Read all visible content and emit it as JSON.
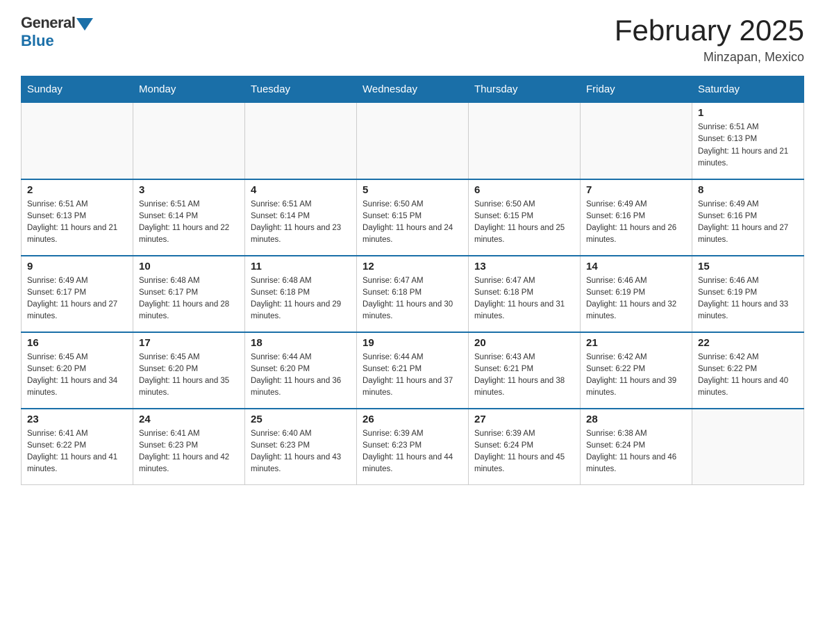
{
  "header": {
    "logo_general": "General",
    "logo_blue": "Blue",
    "month_title": "February 2025",
    "location": "Minzapan, Mexico"
  },
  "days_of_week": [
    "Sunday",
    "Monday",
    "Tuesday",
    "Wednesday",
    "Thursday",
    "Friday",
    "Saturday"
  ],
  "weeks": [
    [
      {
        "day": "",
        "sunrise": "",
        "sunset": "",
        "daylight": ""
      },
      {
        "day": "",
        "sunrise": "",
        "sunset": "",
        "daylight": ""
      },
      {
        "day": "",
        "sunrise": "",
        "sunset": "",
        "daylight": ""
      },
      {
        "day": "",
        "sunrise": "",
        "sunset": "",
        "daylight": ""
      },
      {
        "day": "",
        "sunrise": "",
        "sunset": "",
        "daylight": ""
      },
      {
        "day": "",
        "sunrise": "",
        "sunset": "",
        "daylight": ""
      },
      {
        "day": "1",
        "sunrise": "Sunrise: 6:51 AM",
        "sunset": "Sunset: 6:13 PM",
        "daylight": "Daylight: 11 hours and 21 minutes."
      }
    ],
    [
      {
        "day": "2",
        "sunrise": "Sunrise: 6:51 AM",
        "sunset": "Sunset: 6:13 PM",
        "daylight": "Daylight: 11 hours and 21 minutes."
      },
      {
        "day": "3",
        "sunrise": "Sunrise: 6:51 AM",
        "sunset": "Sunset: 6:14 PM",
        "daylight": "Daylight: 11 hours and 22 minutes."
      },
      {
        "day": "4",
        "sunrise": "Sunrise: 6:51 AM",
        "sunset": "Sunset: 6:14 PM",
        "daylight": "Daylight: 11 hours and 23 minutes."
      },
      {
        "day": "5",
        "sunrise": "Sunrise: 6:50 AM",
        "sunset": "Sunset: 6:15 PM",
        "daylight": "Daylight: 11 hours and 24 minutes."
      },
      {
        "day": "6",
        "sunrise": "Sunrise: 6:50 AM",
        "sunset": "Sunset: 6:15 PM",
        "daylight": "Daylight: 11 hours and 25 minutes."
      },
      {
        "day": "7",
        "sunrise": "Sunrise: 6:49 AM",
        "sunset": "Sunset: 6:16 PM",
        "daylight": "Daylight: 11 hours and 26 minutes."
      },
      {
        "day": "8",
        "sunrise": "Sunrise: 6:49 AM",
        "sunset": "Sunset: 6:16 PM",
        "daylight": "Daylight: 11 hours and 27 minutes."
      }
    ],
    [
      {
        "day": "9",
        "sunrise": "Sunrise: 6:49 AM",
        "sunset": "Sunset: 6:17 PM",
        "daylight": "Daylight: 11 hours and 27 minutes."
      },
      {
        "day": "10",
        "sunrise": "Sunrise: 6:48 AM",
        "sunset": "Sunset: 6:17 PM",
        "daylight": "Daylight: 11 hours and 28 minutes."
      },
      {
        "day": "11",
        "sunrise": "Sunrise: 6:48 AM",
        "sunset": "Sunset: 6:18 PM",
        "daylight": "Daylight: 11 hours and 29 minutes."
      },
      {
        "day": "12",
        "sunrise": "Sunrise: 6:47 AM",
        "sunset": "Sunset: 6:18 PM",
        "daylight": "Daylight: 11 hours and 30 minutes."
      },
      {
        "day": "13",
        "sunrise": "Sunrise: 6:47 AM",
        "sunset": "Sunset: 6:18 PM",
        "daylight": "Daylight: 11 hours and 31 minutes."
      },
      {
        "day": "14",
        "sunrise": "Sunrise: 6:46 AM",
        "sunset": "Sunset: 6:19 PM",
        "daylight": "Daylight: 11 hours and 32 minutes."
      },
      {
        "day": "15",
        "sunrise": "Sunrise: 6:46 AM",
        "sunset": "Sunset: 6:19 PM",
        "daylight": "Daylight: 11 hours and 33 minutes."
      }
    ],
    [
      {
        "day": "16",
        "sunrise": "Sunrise: 6:45 AM",
        "sunset": "Sunset: 6:20 PM",
        "daylight": "Daylight: 11 hours and 34 minutes."
      },
      {
        "day": "17",
        "sunrise": "Sunrise: 6:45 AM",
        "sunset": "Sunset: 6:20 PM",
        "daylight": "Daylight: 11 hours and 35 minutes."
      },
      {
        "day": "18",
        "sunrise": "Sunrise: 6:44 AM",
        "sunset": "Sunset: 6:20 PM",
        "daylight": "Daylight: 11 hours and 36 minutes."
      },
      {
        "day": "19",
        "sunrise": "Sunrise: 6:44 AM",
        "sunset": "Sunset: 6:21 PM",
        "daylight": "Daylight: 11 hours and 37 minutes."
      },
      {
        "day": "20",
        "sunrise": "Sunrise: 6:43 AM",
        "sunset": "Sunset: 6:21 PM",
        "daylight": "Daylight: 11 hours and 38 minutes."
      },
      {
        "day": "21",
        "sunrise": "Sunrise: 6:42 AM",
        "sunset": "Sunset: 6:22 PM",
        "daylight": "Daylight: 11 hours and 39 minutes."
      },
      {
        "day": "22",
        "sunrise": "Sunrise: 6:42 AM",
        "sunset": "Sunset: 6:22 PM",
        "daylight": "Daylight: 11 hours and 40 minutes."
      }
    ],
    [
      {
        "day": "23",
        "sunrise": "Sunrise: 6:41 AM",
        "sunset": "Sunset: 6:22 PM",
        "daylight": "Daylight: 11 hours and 41 minutes."
      },
      {
        "day": "24",
        "sunrise": "Sunrise: 6:41 AM",
        "sunset": "Sunset: 6:23 PM",
        "daylight": "Daylight: 11 hours and 42 minutes."
      },
      {
        "day": "25",
        "sunrise": "Sunrise: 6:40 AM",
        "sunset": "Sunset: 6:23 PM",
        "daylight": "Daylight: 11 hours and 43 minutes."
      },
      {
        "day": "26",
        "sunrise": "Sunrise: 6:39 AM",
        "sunset": "Sunset: 6:23 PM",
        "daylight": "Daylight: 11 hours and 44 minutes."
      },
      {
        "day": "27",
        "sunrise": "Sunrise: 6:39 AM",
        "sunset": "Sunset: 6:24 PM",
        "daylight": "Daylight: 11 hours and 45 minutes."
      },
      {
        "day": "28",
        "sunrise": "Sunrise: 6:38 AM",
        "sunset": "Sunset: 6:24 PM",
        "daylight": "Daylight: 11 hours and 46 minutes."
      },
      {
        "day": "",
        "sunrise": "",
        "sunset": "",
        "daylight": ""
      }
    ]
  ]
}
